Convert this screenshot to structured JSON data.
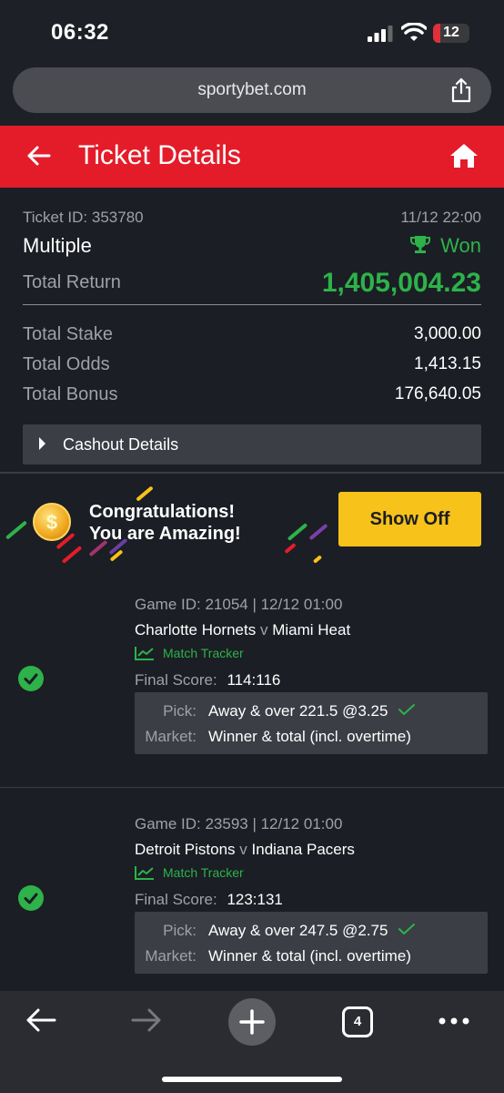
{
  "status_bar": {
    "time": "06:32",
    "battery": "12"
  },
  "browser": {
    "url": "sportybet.com",
    "tab_count": "4"
  },
  "header": {
    "title": "Ticket Details"
  },
  "ticket": {
    "id_label": "Ticket ID: 353780",
    "datetime": "11/12 22:00",
    "type": "Multiple",
    "status": "Won",
    "total_return_label": "Total Return",
    "total_return": "1,405,004.23",
    "total_stake_label": "Total Stake",
    "total_stake": "3,000.00",
    "total_odds_label": "Total Odds",
    "total_odds": "1,413.15",
    "total_bonus_label": "Total Bonus",
    "total_bonus": "176,640.05",
    "cashout_label": "Cashout Details"
  },
  "promo": {
    "coin": "$",
    "line1": "Congratulations!",
    "line2": "You are Amazing!",
    "button": "Show Off"
  },
  "games": [
    {
      "game_id": "Game ID: 21054 | 12/12 01:00",
      "home": "Charlotte Hornets",
      "vs": "v",
      "away": "Miami Heat",
      "tracker": "Match Tracker",
      "score_label": "Final Score:",
      "score": "114:116",
      "pick_label": "Pick:",
      "pick": "Away & over 221.5 @3.25",
      "market_label": "Market:",
      "market": "Winner & total (incl. overtime)"
    },
    {
      "game_id": "Game ID: 23593 | 12/12 01:00",
      "home": "Detroit Pistons",
      "vs": "v",
      "away": "Indiana Pacers",
      "tracker": "Match Tracker",
      "score_label": "Final Score:",
      "score": "123:131",
      "pick_label": "Pick:",
      "pick": "Away & over 247.5 @2.75",
      "market_label": "Market:",
      "market": "Winner & total (incl. overtime)"
    }
  ],
  "colors": {
    "brand_red": "#e41c2a",
    "win_green": "#2eb24a",
    "accent_yellow": "#f7c21a"
  }
}
